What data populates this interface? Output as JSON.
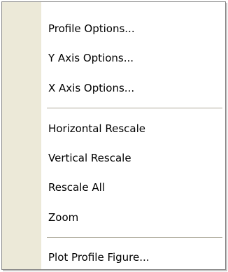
{
  "menu": {
    "items": [
      {
        "label": "Profile Options..."
      },
      {
        "label": "Y Axis Options..."
      },
      {
        "label": "X Axis Options..."
      },
      {
        "label": "Horizontal Rescale"
      },
      {
        "label": "Vertical Rescale"
      },
      {
        "label": "Rescale All"
      },
      {
        "label": "Zoom"
      },
      {
        "label": "Plot Profile Figure..."
      }
    ]
  },
  "colors": {
    "gutter": "#ece9d8",
    "border": "#868686",
    "separator": "#aca899",
    "text": "#000000"
  }
}
